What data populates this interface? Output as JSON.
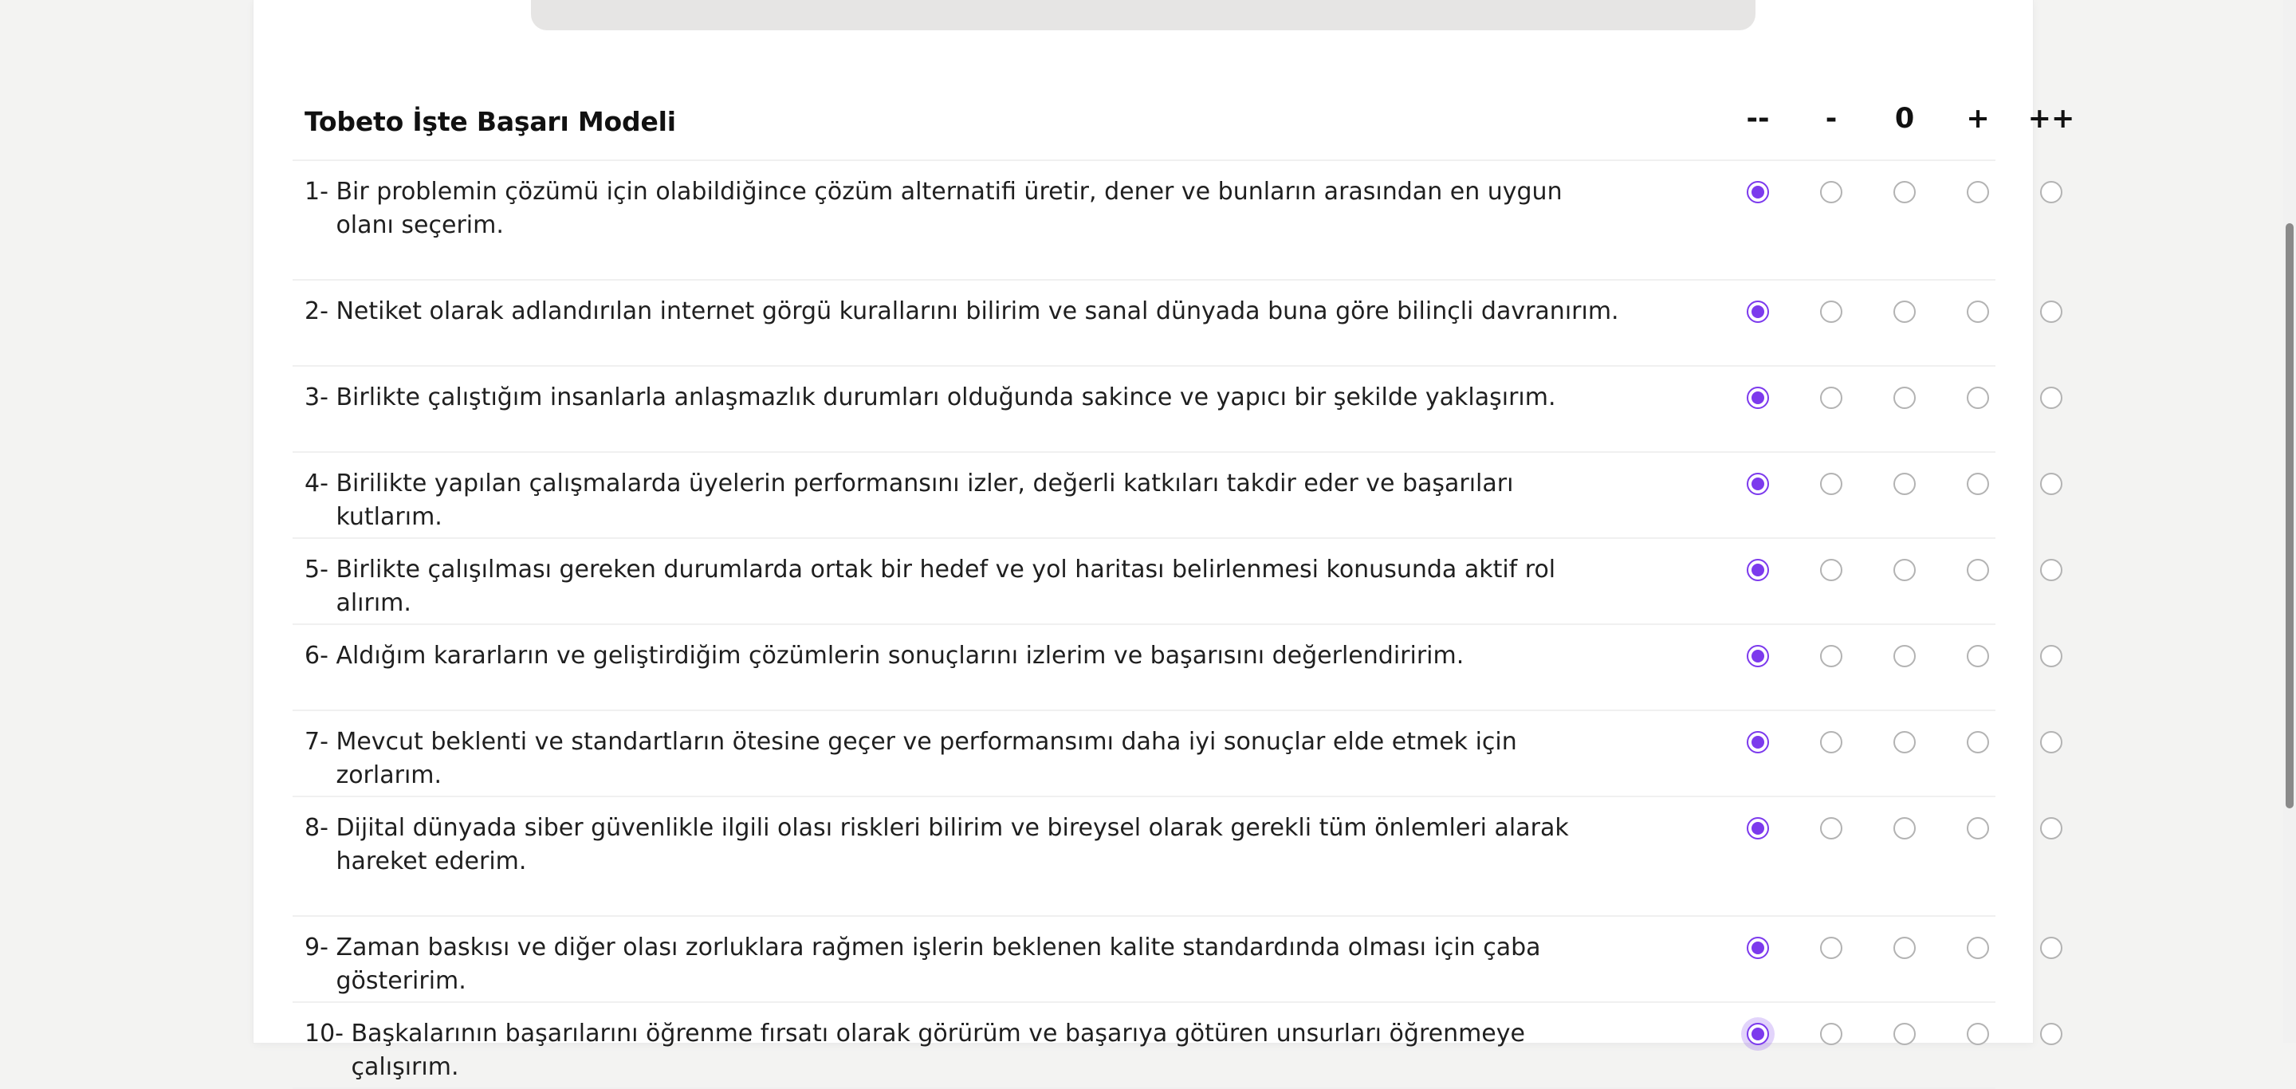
{
  "survey": {
    "title": "Tobeto İşte Başarı Modeli",
    "scale": [
      "--",
      "-",
      "0",
      "+",
      "++"
    ],
    "questions": [
      {
        "number": "1- ",
        "text": "Bir problemin çözümü için olabildiğince çözüm alternatifi üretir, dener ve bunların arasından en uygun olanı seçerim.",
        "selected": 0
      },
      {
        "number": "2- ",
        "text": "Netiket olarak adlandırılan internet görgü kurallarını bilirim ve sanal dünyada buna göre bilinçli davranırım.",
        "selected": 0
      },
      {
        "number": "3- ",
        "text": "Birlikte çalıştığım insanlarla anlaşmazlık durumları olduğunda sakince ve yapıcı bir şekilde yaklaşırım.",
        "selected": 0
      },
      {
        "number": "4- ",
        "text": "Birilikte yapılan çalışmalarda üyelerin performansını izler, değerli katkıları takdir eder ve başarıları kutlarım.",
        "selected": 0
      },
      {
        "number": "5- ",
        "text": "Birlikte çalışılması gereken durumlarda ortak bir hedef ve yol haritası belirlenmesi konusunda aktif rol alırım.",
        "selected": 0
      },
      {
        "number": "6- ",
        "text": "Aldığım kararların ve geliştirdiğim çözümlerin sonuçlarını izlerim ve başarısını değerlendiririm.",
        "selected": 0
      },
      {
        "number": "7- ",
        "text": "Mevcut beklenti ve standartların ötesine geçer ve performansımı daha iyi sonuçlar elde etmek için zorlarım.",
        "selected": 0
      },
      {
        "number": "8- ",
        "text": "Dijital dünyada siber güvenlikle ilgili olası riskleri bilirim ve bireysel olarak gerekli tüm önlemleri alarak hareket ederim.",
        "selected": 0
      },
      {
        "number": "9- ",
        "text": "Zaman baskısı ve diğer olası zorluklara rağmen işlerin beklenen kalite standardında olması için çaba gösteririm.",
        "selected": 0
      },
      {
        "number": "10- ",
        "text": "Başkalarının başarılarını öğrenme fırsatı olarak görürüm ve başarıya götüren unsurları öğrenmeye çalışırım.",
        "selected": 0
      }
    ]
  },
  "colors": {
    "accent": "#7c3aed",
    "radio_border": "#b3b3b3",
    "page_background": "#f3f3f2"
  }
}
